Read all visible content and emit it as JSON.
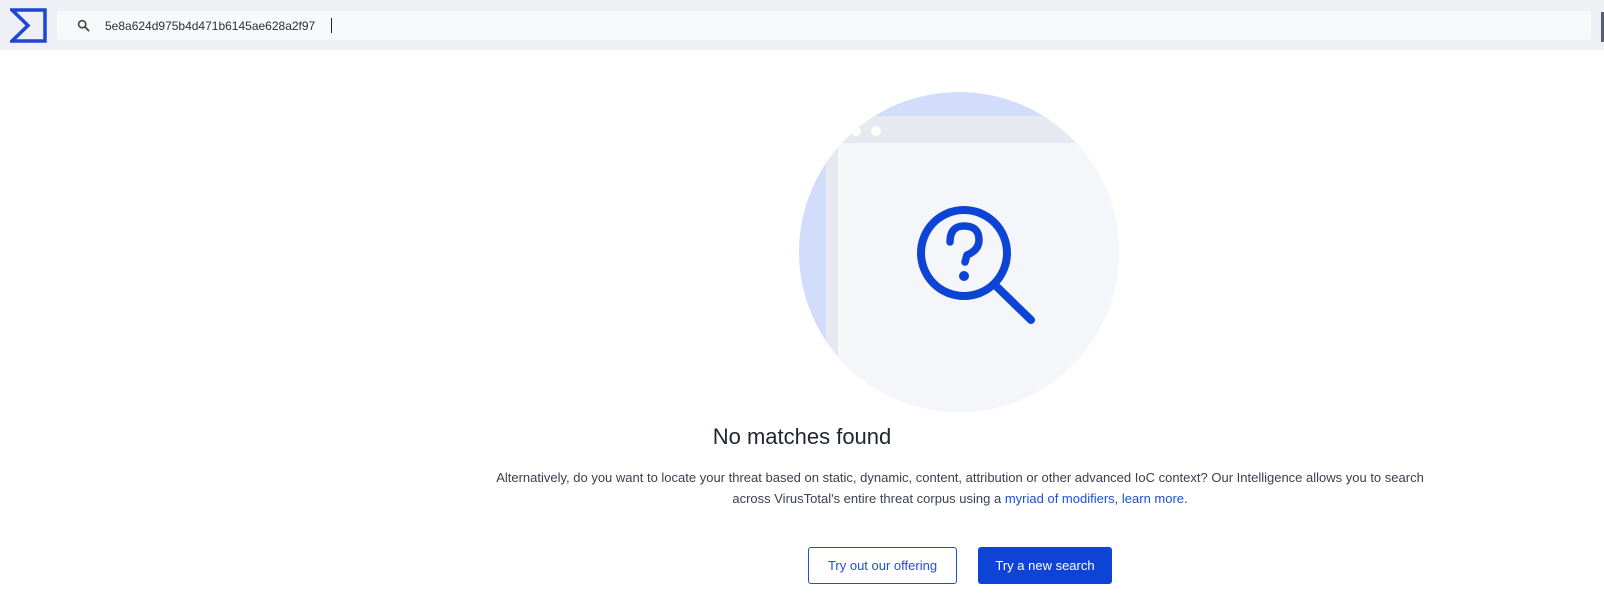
{
  "header": {
    "logo_icon": "sigma-logo-icon",
    "search": {
      "icon": "search-icon",
      "value": "5e8a624d975b4d471b6145ae628a2f97",
      "placeholder": ""
    }
  },
  "empty_state": {
    "illustration_icon": "magnifier-question-icon",
    "title": "No matches found",
    "description_part1": "Alternatively, do you want to locate your threat based on static, dynamic, content, attribution or other advanced IoC context? Our Intelligence allows you to search across VirusTotal's entire threat corpus using a ",
    "link_modifiers": "myriad of modifiers",
    "separator": ", ",
    "link_learn_more": "learn more",
    "description_end": "."
  },
  "actions": {
    "try_offering_label": "Try out our offering",
    "new_search_label": "Try a new search"
  },
  "colors": {
    "accent": "#0d44d6",
    "header_bg": "#eef0f6",
    "illustration_light": "#d2dcfb"
  }
}
